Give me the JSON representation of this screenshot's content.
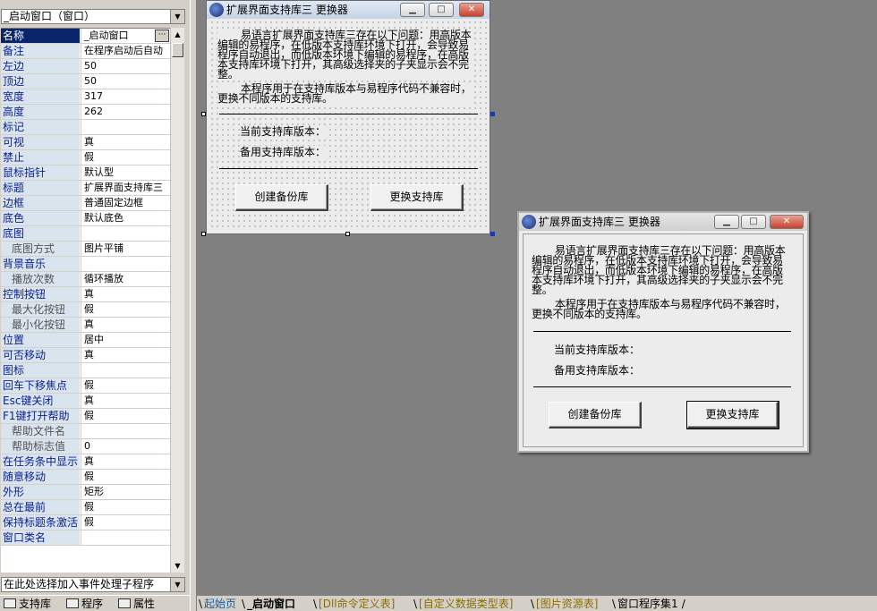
{
  "object_selector": {
    "value": "_启动窗口（窗口）"
  },
  "properties": [
    {
      "name": "名称",
      "value": "_启动窗口",
      "selected": true,
      "has_button": true,
      "button_label": "···"
    },
    {
      "name": "备注",
      "value": "在程序启动后自动"
    },
    {
      "name": "左边",
      "value": "50"
    },
    {
      "name": "顶边",
      "value": "50"
    },
    {
      "name": "宽度",
      "value": "317"
    },
    {
      "name": "高度",
      "value": "262"
    },
    {
      "name": "标记",
      "value": ""
    },
    {
      "name": "可视",
      "value": "真"
    },
    {
      "name": "禁止",
      "value": "假"
    },
    {
      "name": "鼠标指针",
      "value": "默认型"
    },
    {
      "name": "标题",
      "value": "扩展界面支持库三"
    },
    {
      "name": "边框",
      "value": "普通固定边框"
    },
    {
      "name": "底色",
      "value": "默认底色"
    },
    {
      "name": "底图",
      "value": ""
    },
    {
      "name": "底图方式",
      "value": "图片平铺",
      "sub": true
    },
    {
      "name": "背景音乐",
      "value": ""
    },
    {
      "name": "播放次数",
      "value": "循环播放",
      "sub": true
    },
    {
      "name": "控制按钮",
      "value": "真"
    },
    {
      "name": "最大化按钮",
      "value": "假",
      "sub": true
    },
    {
      "name": "最小化按钮",
      "value": "真",
      "sub": true
    },
    {
      "name": "位置",
      "value": "居中"
    },
    {
      "name": "可否移动",
      "value": "真"
    },
    {
      "name": "图标",
      "value": ""
    },
    {
      "name": "回车下移焦点",
      "value": "假"
    },
    {
      "name": "Esc键关闭",
      "value": "真"
    },
    {
      "name": "F1键打开帮助",
      "value": "假"
    },
    {
      "name": "帮助文件名",
      "value": "",
      "sub": true
    },
    {
      "name": "帮助标志值",
      "value": "0",
      "sub": true
    },
    {
      "name": "在任务条中显示",
      "value": "真"
    },
    {
      "name": "随意移动",
      "value": "假"
    },
    {
      "name": "外形",
      "value": "矩形"
    },
    {
      "name": "总在最前",
      "value": "假"
    },
    {
      "name": "保持标题条激活",
      "value": "假"
    },
    {
      "name": "窗口类名",
      "value": ""
    }
  ],
  "event_selector": {
    "value": "在此处选择加入事件处理子程序"
  },
  "left_tabs": [
    "支持库",
    "程序",
    "属性"
  ],
  "bottom_tabs": [
    "起始页",
    "_启动窗口",
    "[Dll命令定义表]",
    "[自定义数据类型表]",
    "[图片资源表]",
    "窗口程序集1"
  ],
  "dialog": {
    "title": "扩展界面支持库三 更换器",
    "description_lines": [
      "易语言扩展界面支持库三存在以下问题：用高版本",
      "编辑的易程序，在低版本支持库环境下打开，会导致易",
      "程序自动退出，而低版本环境下编辑的易程序，在高版",
      "本支持库环境下打开，其高级选择夹的子夹显示会不完",
      "整。"
    ],
    "note_lines": [
      "本程序用于在支持库版本与易程序代码不兼容时，",
      "更换不同版本的支持库。"
    ],
    "current_label": "当前支持库版本：",
    "backup_label": "备用支持库版本：",
    "create_backup_button": "创建备份库",
    "replace_button": "更换支持库",
    "min_button": "▁",
    "max_button": "□",
    "close_button": "✕"
  },
  "colors": {
    "workspace": "#808080",
    "selected_property": "#0a246a",
    "property_name": "#0b238f"
  }
}
